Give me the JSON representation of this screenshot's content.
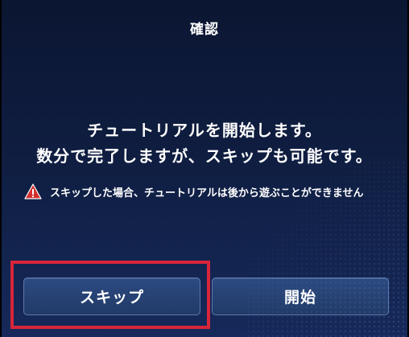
{
  "dialog": {
    "title": "確認",
    "message_lines": [
      "チュートリアルを開始します。",
      "数分で完了しますが、スキップも可能です。"
    ],
    "warning": {
      "icon": "warning-triangle-icon",
      "text": "スキップした場合、チュートリアルは後から遊ぶことができません"
    },
    "buttons": {
      "skip_label": "スキップ",
      "start_label": "開始"
    }
  },
  "colors": {
    "background_top": "#0b1632",
    "background_bottom": "#16295a",
    "button_fill": "#2c4a80",
    "button_border": "#5c79ad",
    "highlight": "#d8253a",
    "warning_icon": "#d32f2f"
  }
}
